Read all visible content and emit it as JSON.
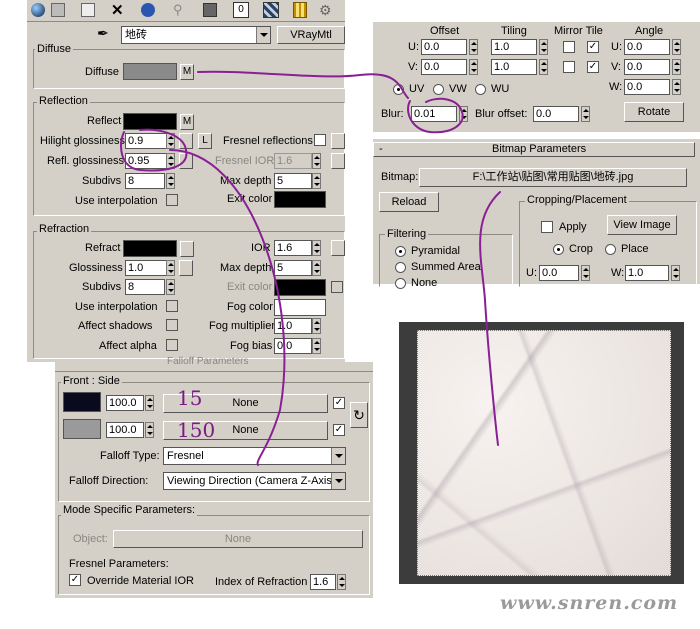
{
  "toolbar": {
    "icons": [
      "sphere-icon",
      "multi-material-icon",
      "copy-icon",
      "delete-icon",
      "link-icon",
      "tree-icon",
      "put-to-library-icon",
      "material-id-icon",
      "show-map-icon",
      "show-end-result-icon",
      "go-forward-icon"
    ]
  },
  "material": {
    "picker_icon": "eyedropper-icon",
    "name": "地砖",
    "type": "VRayMtl"
  },
  "diffuse": {
    "section": "Diffuse",
    "label": "Diffuse",
    "map_btn": "M",
    "color": "#8a8a8a"
  },
  "reflection": {
    "section": "Reflection",
    "reflect": "Reflect",
    "reflect_color": "#000000",
    "map_btn": "M",
    "hilight": "Hilight glossiness",
    "hilight_val": "0.9",
    "l_btn": "L",
    "fresnel": "Fresnel reflections",
    "refl_gloss": "Refl. glossiness",
    "refl_gloss_val": "0.95",
    "fresnel_ior": "Fresnel IOR",
    "fresnel_ior_val": "1.6",
    "subdivs": "Subdivs",
    "subdivs_val": "8",
    "max_depth": "Max depth",
    "max_depth_val": "5",
    "use_interp": "Use interpolation",
    "exit_color": "Exit color",
    "exit_color_val": "#000000"
  },
  "refraction": {
    "section": "Refraction",
    "refract": "Refract",
    "refract_color": "#000000",
    "ior": "IOR",
    "ior_val": "1.6",
    "glossiness": "Glossiness",
    "glossiness_val": "1.0",
    "max_depth": "Max depth",
    "max_depth_val": "5",
    "subdivs": "Subdivs",
    "subdivs_val": "8",
    "exit_color": "Exit color",
    "use_interp": "Use interpolation",
    "fog_color": "Fog color",
    "fog_color_val": "#ffffff",
    "affect_shadows": "Affect shadows",
    "fog_mult": "Fog multiplier",
    "fog_mult_val": "1.0",
    "affect_alpha": "Affect alpha",
    "fog_bias": "Fog bias",
    "fog_bias_val": "0.0"
  },
  "falloff": {
    "header": "Falloff Parameters",
    "front_side": "Front : Side",
    "front_val": "100.0",
    "front_color": "#0a0a1e",
    "front_map": "None",
    "side_val": "100.0",
    "side_color": "#9a9a9a",
    "side_map": "None",
    "note1": "15",
    "note2": "150",
    "type_label": "Falloff Type:",
    "type_val": "Fresnel",
    "dir_label": "Falloff Direction:",
    "dir_val": "Viewing Direction (Camera Z-Axis)",
    "mode_section": "Mode Specific Parameters:",
    "object_label": "Object:",
    "object_val": "None",
    "fresnel_params": "Fresnel Parameters:",
    "override_ior": "Override Material IOR",
    "index_label": "Index of Refraction",
    "index_val": "1.6"
  },
  "coords": {
    "col_offset": "Offset",
    "col_tiling": "Tiling",
    "col_mirror_tile": "Mirror Tile",
    "col_angle": "Angle",
    "u_label": "U:",
    "v_label": "V:",
    "w_label": "W:",
    "u_offset": "0.0",
    "v_offset": "0.0",
    "u_tiling": "1.0",
    "v_tiling": "1.0",
    "u_angle": "0.0",
    "v_angle": "0.0",
    "w_angle": "0.0",
    "uv": "UV",
    "vw": "VW",
    "wu": "WU",
    "blur": "Blur:",
    "blur_val": "0.01",
    "blur_offset": "Blur offset:",
    "blur_offset_val": "0.0",
    "rotate": "Rotate"
  },
  "bitmap": {
    "header": "Bitmap Parameters",
    "collapse": "-",
    "label": "Bitmap:",
    "path": "F:\\工作站\\贴图\\常用贴图\\地砖.jpg",
    "reload": "Reload",
    "cropping": "Cropping/Placement",
    "apply": "Apply",
    "view_image": "View Image",
    "crop": "Crop",
    "place": "Place",
    "u_label": "U:",
    "u_val": "0.0",
    "w_label": "W:",
    "w_val": "1.0",
    "filtering": "Filtering",
    "pyramidal": "Pyramidal",
    "summed": "Summed Area",
    "none": "None"
  },
  "watermark": "www.snren.com",
  "colors": {
    "panel": "#d4d0c8",
    "annotation": "#7a1a82"
  }
}
